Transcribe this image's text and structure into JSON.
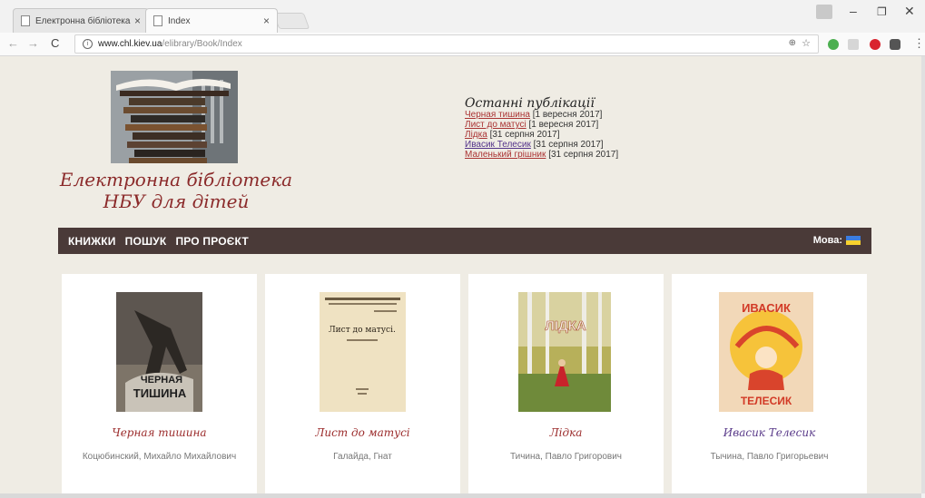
{
  "browser": {
    "tabs": [
      {
        "label": "Електронна бібліотека"
      },
      {
        "label": "Index"
      }
    ],
    "url_domain": "www.chl.kiev.ua",
    "url_path": "/elibrary/Book/Index"
  },
  "site": {
    "title_line1": "Електронна бібліотека",
    "title_line2": "НБУ для дітей",
    "recent": {
      "heading": "Останні публікації",
      "items": [
        {
          "title": "Черная тишина",
          "date": "[1 вересня 2017]"
        },
        {
          "title": "Лист до матусі",
          "date": "[1 вересня 2017]"
        },
        {
          "title": "Лідка",
          "date": "[31 серпня 2017]"
        },
        {
          "title": "Ивасик Телесик",
          "date": "[31 серпня 2017]"
        },
        {
          "title": "Маленький грішник",
          "date": "[31 серпня 2017]"
        }
      ]
    },
    "nav": {
      "items": [
        "КНИЖКИ",
        "ПОШУК",
        "ПРО ПРОЄКТ"
      ],
      "lang_label": "Мова:"
    }
  },
  "books": [
    {
      "title": "Черная тишина",
      "author": "Коцюбинский, Михайло Михайлович"
    },
    {
      "title": "Лист до матусі",
      "author": "Галайда, Гнат"
    },
    {
      "title": "Лідка",
      "author": "Тичина, Павло Григорович"
    },
    {
      "title": "Ивасик Телесик",
      "author": "Тычина, Павло Григорьевич"
    }
  ],
  "cover_texts": {
    "book1": "ЧЕРНАЯ ТИШИНА",
    "book2": "Лист до матусі.",
    "book3": "ЛІДКА",
    "book4_top": "ИВАСИК",
    "book4_bottom": "ТЕЛЕСИК"
  },
  "colors": {
    "page_bg": "#efece4",
    "nav_bg": "#4a3a38",
    "title_red": "#8b2a2a",
    "link_red": "#a33333",
    "visited_purple": "#53328a"
  }
}
